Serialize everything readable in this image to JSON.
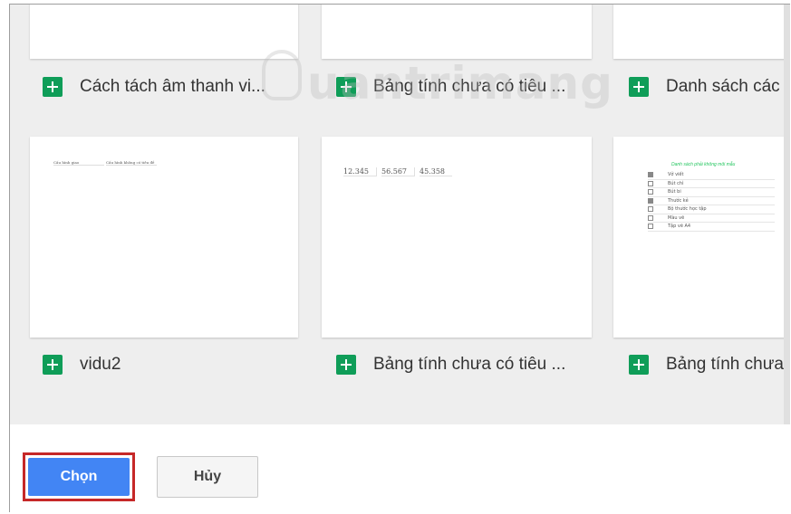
{
  "files": [
    {
      "name": "Cách tách âm thanh vi..."
    },
    {
      "name": "Bảng tính chưa có tiêu ..."
    },
    {
      "name": "Danh sách các"
    },
    {
      "name": "vidu2"
    },
    {
      "name": "Bảng tính chưa có tiêu ..."
    },
    {
      "name": "Bảng tính chưa"
    }
  ],
  "thumbnails": {
    "vidu2": {
      "cells": [
        "Cấu hình giao",
        "Cấu hình không có tiêu đề"
      ]
    },
    "numbers": {
      "cells": [
        "12.345",
        "56.567",
        "45.358"
      ]
    },
    "checklist": {
      "title": "Danh sách phải không môi mẫu",
      "items": [
        "Vở viết",
        "Bút chì",
        "Bút bi",
        "Thước kẻ",
        "Bộ thước học tập",
        "Màu vẽ",
        "Tập vẽ A4"
      ]
    }
  },
  "watermark": {
    "text": "uantrimang"
  },
  "footer": {
    "select_label": "Chọn",
    "cancel_label": "Hủy"
  },
  "colors": {
    "sheets_green": "#0f9d58",
    "primary_blue": "#4285f4",
    "highlight_red": "#c62828"
  }
}
